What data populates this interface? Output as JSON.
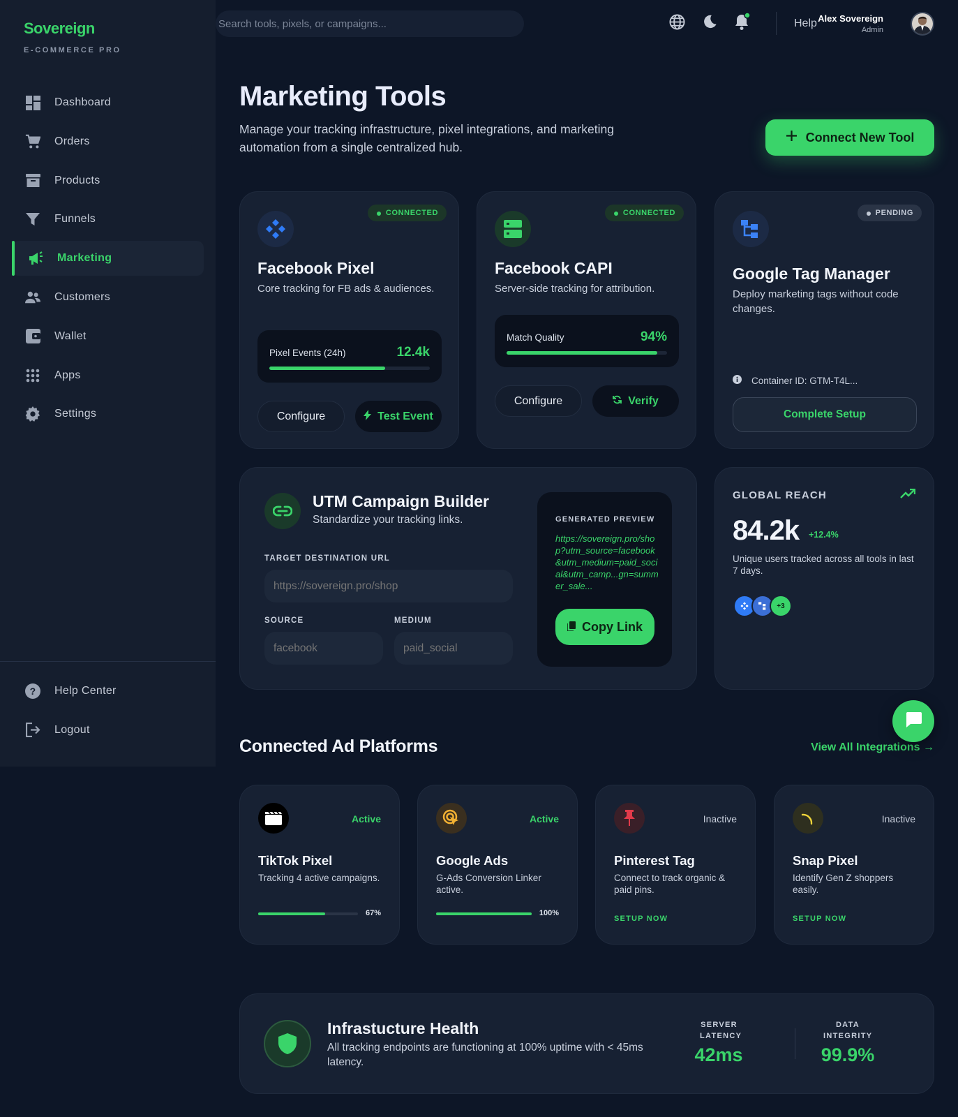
{
  "brand": {
    "name": "Sovereign",
    "tagline": "E-COMMERCE PRO"
  },
  "nav": {
    "items": [
      {
        "label": "Dashboard",
        "icon": "dashboard-icon"
      },
      {
        "label": "Orders",
        "icon": "cart-icon"
      },
      {
        "label": "Products",
        "icon": "archive-icon"
      },
      {
        "label": "Funnels",
        "icon": "funnel-icon"
      },
      {
        "label": "Marketing",
        "icon": "megaphone-icon",
        "active": true
      },
      {
        "label": "Customers",
        "icon": "people-icon"
      },
      {
        "label": "Wallet",
        "icon": "wallet-icon"
      },
      {
        "label": "Apps",
        "icon": "grid-icon"
      },
      {
        "label": "Settings",
        "icon": "gear-icon"
      }
    ],
    "bottom": [
      {
        "label": "Help Center",
        "icon": "help-icon"
      },
      {
        "label": "Logout",
        "icon": "logout-icon"
      }
    ]
  },
  "topbar": {
    "search_placeholder": "Search tools, pixels, or campaigns...",
    "help": "Help",
    "user_name": "Alex Sovereign",
    "user_role": "Admin"
  },
  "page": {
    "title": "Marketing Tools",
    "subtitle": "Manage your tracking infrastructure, pixel integrations, and marketing automation from a single centralized hub.",
    "connect_button": "Connect New Tool"
  },
  "tools": [
    {
      "title": "Facebook Pixel",
      "desc": "Core tracking for FB ads & audiences.",
      "status": "CONNECTED",
      "metric_label": "Pixel Events (24h)",
      "metric_value": "12.4k",
      "progress": 0.72,
      "btn_secondary": "Configure",
      "btn_primary": "Test Event"
    },
    {
      "title": "Facebook CAPI",
      "desc": "Server-side tracking for attribution.",
      "status": "CONNECTED",
      "metric_label": "Match Quality",
      "metric_value": "94%",
      "progress": 0.94,
      "btn_secondary": "Configure",
      "btn_primary": "Verify"
    },
    {
      "title": "Google Tag Manager",
      "desc": "Deploy marketing tags without code changes.",
      "status": "PENDING",
      "container_id": "Container ID: GTM-T4L...",
      "btn_setup": "Complete Setup"
    }
  ],
  "utm": {
    "title": "UTM Campaign Builder",
    "subtitle": "Standardize your tracking links.",
    "url_label": "TARGET DESTINATION URL",
    "url_placeholder": "https://sovereign.pro/shop",
    "source_label": "SOURCE",
    "source_placeholder": "facebook",
    "medium_label": "MEDIUM",
    "medium_placeholder": "paid_social",
    "preview_label": "GENERATED PREVIEW",
    "preview_url": "https://sovereign.pro/shop?utm_source=facebook&utm_medium=paid_social&utm_camp...gn=summer_sale...",
    "copy_button": "Copy Link"
  },
  "reach": {
    "label": "GLOBAL REACH",
    "value": "84.2k",
    "delta": "+12.4%",
    "desc": "Unique users tracked across all tools in last 7 days.",
    "more": "+3"
  },
  "platforms": {
    "title": "Connected Ad Platforms",
    "view_all": "View All Integrations →",
    "items": [
      {
        "name": "TikTok Pixel",
        "desc": "Tracking 4 active campaigns.",
        "status": "Active",
        "progress": 0.67,
        "pct": "67%"
      },
      {
        "name": "Google Ads",
        "desc": "G-Ads Conversion Linker active.",
        "status": "Active",
        "progress": 1.0,
        "pct": "100%"
      },
      {
        "name": "Pinterest Tag",
        "desc": "Connect to track organic & paid pins.",
        "status": "Inactive",
        "action": "SETUP NOW"
      },
      {
        "name": "Snap Pixel",
        "desc": "Identify Gen Z shoppers easily.",
        "status": "Inactive",
        "action": "SETUP NOW"
      }
    ]
  },
  "health": {
    "title": "Infrastucture Health",
    "desc": "All tracking endpoints are functioning at 100% uptime with < 45ms latency.",
    "latency_label": "SERVER LATENCY",
    "latency_value": "42ms",
    "integrity_label": "DATA INTEGRITY",
    "integrity_value": "99.9%"
  },
  "colors": {
    "accent": "#3ad46a",
    "background": "#0d1627",
    "card": "#172133",
    "sidebar": "#151e2e"
  }
}
